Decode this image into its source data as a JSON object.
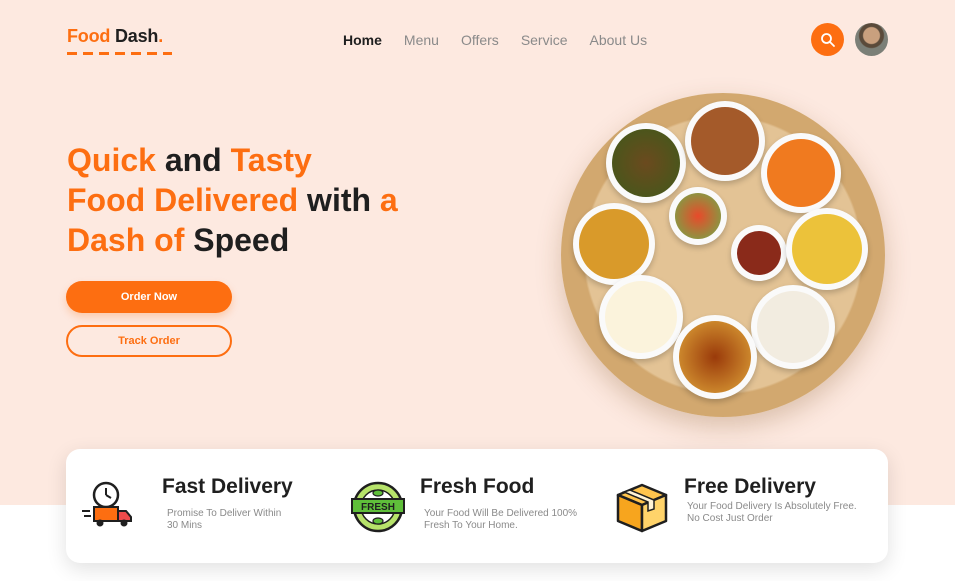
{
  "brand": {
    "part1": "Food",
    "part2": "Dash",
    "dot": "."
  },
  "nav": [
    {
      "label": "Home",
      "active": true
    },
    {
      "label": "Menu",
      "active": false
    },
    {
      "label": "Offers",
      "active": false
    },
    {
      "label": "Service",
      "active": false
    },
    {
      "label": "About Us",
      "active": false
    }
  ],
  "header": {
    "search_icon": "search-icon",
    "avatar": "user-avatar"
  },
  "hero": {
    "line1": [
      "Quick",
      " and ",
      "Tasty"
    ],
    "line2": [
      "Food Delivered",
      " with ",
      "a"
    ],
    "line3": [
      "Dash of",
      " Speed"
    ],
    "order_button": "Order Now",
    "track_button": "Track Order"
  },
  "features": [
    {
      "title": "Fast Delivery",
      "desc": "Promise To Deliver Within 30 Mins",
      "icon": "delivery-truck-icon"
    },
    {
      "title": "Fresh Food",
      "desc": "Your Food Will Be Delivered 100% Fresh To Your Home.",
      "icon": "fresh-badge-icon",
      "badge_text": "FRESH"
    },
    {
      "title": "Free Delivery",
      "desc": "Your Food Delivery Is Absolutely Free. No Cost Just Order",
      "icon": "package-box-icon"
    }
  ],
  "colors": {
    "accent": "#fd6e11",
    "hero_bg": "#fde9e0",
    "text_dark": "#1f1f1f",
    "text_muted": "#8a8a8a"
  }
}
